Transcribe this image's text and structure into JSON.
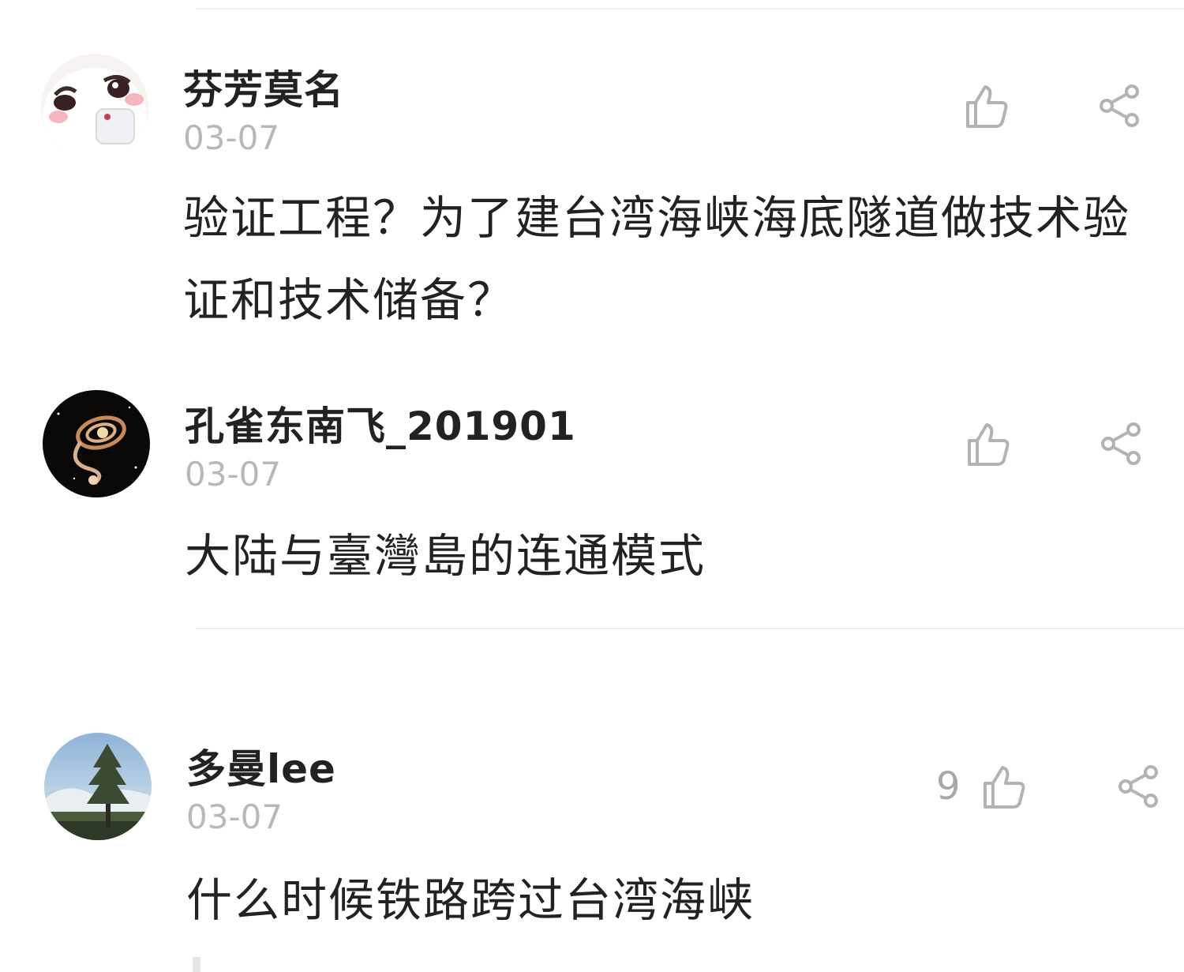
{
  "comments": [
    {
      "username": "芬芳莫名",
      "date": "03-07",
      "text": "验证工程？为了建台湾海峡海底隧道做技术验证和技术储备？",
      "like_count": "",
      "avatar": "cartoon-face-icon"
    },
    {
      "username": "孔雀东南飞_201901",
      "date": "03-07",
      "text": "大陆与臺灣島的连通模式",
      "like_count": "",
      "avatar": "galaxy-image"
    },
    {
      "username": "多曼lee",
      "date": "03-07",
      "text": "什么时候铁路跨过台湾海峡",
      "like_count": "9",
      "avatar": "pine-tree-image"
    }
  ],
  "icons": {
    "like": "thumbs-up-icon",
    "share": "share-icon"
  },
  "colors": {
    "text": "#222222",
    "muted": "#b8b8b8",
    "icon": "#b3b3b3",
    "divider": "#eeeeee"
  }
}
